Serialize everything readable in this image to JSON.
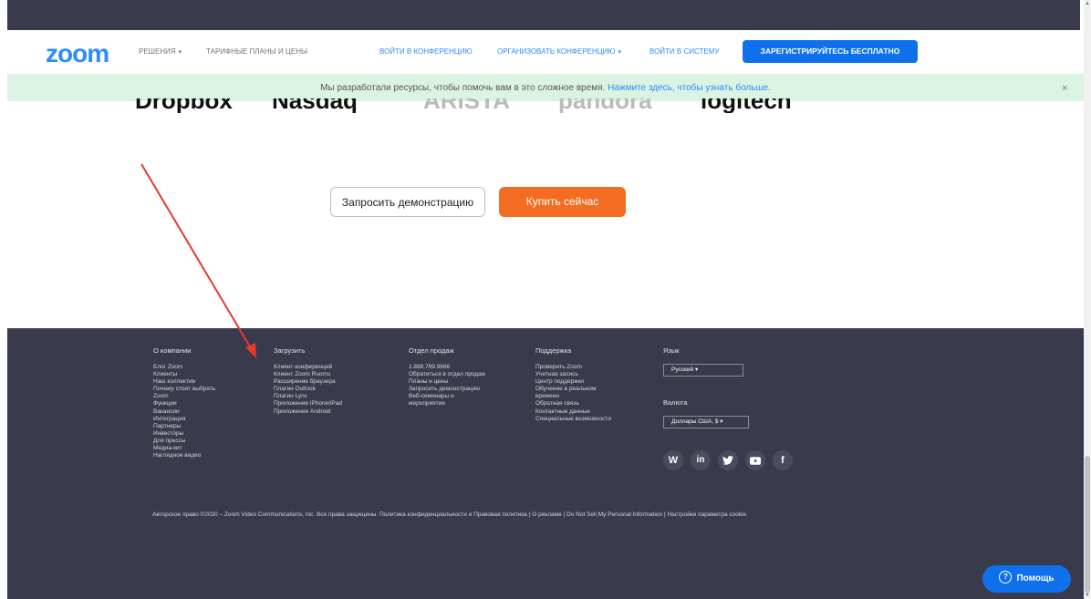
{
  "nav": {
    "logo": "zoom",
    "solutions": "РЕШЕНИЯ",
    "plans": "ТАРИФНЫЕ ПЛАНЫ И ЦЕНЫ",
    "join": "ВОЙТИ В КОНФЕРЕНЦИЮ",
    "host": "ОРГАНИЗОВАТЬ КОНФЕРЕНЦИЮ",
    "signin": "ВОЙТИ В СИСТЕМУ",
    "signup": "ЗАРЕГИСТРИРУЙТЕСЬ БЕСПЛАТНО"
  },
  "banner": {
    "text": "Мы разработали ресурсы, чтобы помочь вам в это сложное время.",
    "link": "Нажмите здесь, чтобы узнать больше.",
    "close": "×"
  },
  "logos": [
    "Dropbox",
    "Nasdaq",
    "ARISTA",
    "pandora",
    "logitech"
  ],
  "actions": {
    "demo": "Запросить демонстрацию",
    "buy": "Купить сейчас"
  },
  "footer": {
    "about": {
      "title": "О компании",
      "items": [
        "Блог Zoom",
        "Клиенты",
        "Наш коллектив",
        "Почему стоит выбрать",
        "Zoom",
        "Функции",
        "Вакансии",
        "Интеграция",
        "Партнеры",
        "Инвесторы",
        "Для прессы",
        "Медиа-кит",
        "Наглядное видео"
      ]
    },
    "download": {
      "title": "Загрузить",
      "items": [
        "Клиент конференций",
        "Клиент Zoom Rooms",
        "Расширение браузера",
        "Плагин Outlook",
        "Плагин Lync",
        "Приложение iPhone/iPad",
        "Приложение Android"
      ]
    },
    "sales": {
      "title": "Отдел продаж",
      "items": [
        "1.888.799.9666",
        "Обратиться в отдел продаж",
        "Планы и цены",
        "Запросить демонстрацию",
        "Веб-семинары и",
        "мероприятия"
      ]
    },
    "support": {
      "title": "Поддержка",
      "items": [
        "Проверить Zoom",
        "Учетная запись",
        "Центр поддержки",
        "Обучение в реальном",
        "времени",
        "Обратная связь",
        "Контактные данные",
        "Специальные возможности"
      ]
    },
    "language": {
      "title": "Язык",
      "value": "Русский"
    },
    "currency": {
      "title": "Валюта",
      "value": "Доллары США, $"
    },
    "social": [
      "wordpress-icon",
      "linkedin-icon",
      "twitter-icon",
      "youtube-icon",
      "facebook-icon"
    ],
    "copyright": "Авторское право ©2020 – Zoom Video Communications, Inc. Все права защищены.   Политика конфиденциальности и Правовая политика  |  О рекламе  |  Do Not Sell My Personal Information  |  Настройки параметра cookie",
    "help": "Помощь"
  },
  "colors": {
    "brand": "#2d8cff",
    "signup": "#0e71eb",
    "buy": "#f26d21",
    "footer": "#393a4b",
    "banner": "#dbf3e3",
    "arrow": "#e5392b"
  }
}
